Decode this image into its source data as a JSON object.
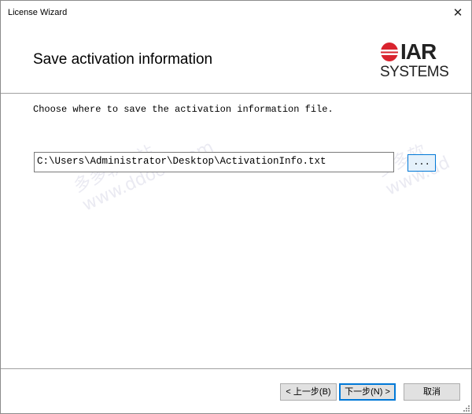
{
  "window": {
    "title": "License Wizard"
  },
  "header": {
    "title": "Save activation information",
    "logo_top": "IAR",
    "logo_bottom": "SYSTEMS"
  },
  "main": {
    "instruction": "Choose where to save the activation information file.",
    "path_value": "C:\\Users\\Administrator\\Desktop\\ActivationInfo.txt",
    "browse_label": "..."
  },
  "buttons": {
    "back": "< 上一步(B)",
    "next": "下一步(N) >",
    "cancel": "取消"
  },
  "icons": {
    "close": "close-icon",
    "logo": "iar-logo-mark-icon"
  },
  "colors": {
    "focus_border": "#0078d7",
    "button_bg": "#e1e1e1",
    "logo_red": "#d9232e"
  }
}
